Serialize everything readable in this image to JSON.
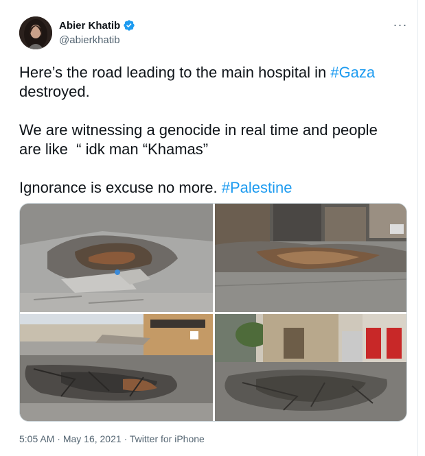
{
  "author": {
    "name": "Abier Khatib",
    "handle": "@abierkhatib",
    "verified": true
  },
  "more_icon": "more-horizontal-icon",
  "tweet": {
    "line1_text": "Here’s the road leading to the main hospital in ",
    "line1_hashtag": "#Gaza",
    "line2": "destroyed.",
    "line3": "We are witnessing a genocide in real time and people",
    "line4": "are like  “ idk man “Khamas”",
    "line5_text": "Ignorance is excuse no more. ",
    "line5_hashtag": "#Palestine"
  },
  "media": {
    "count": 4,
    "photos": [
      "road-crater-photo-1",
      "road-crater-photo-2",
      "road-crater-photo-3",
      "road-crater-photo-4"
    ]
  },
  "meta": {
    "time": "5:05 AM",
    "separator": "·",
    "date": "May 16, 2021",
    "source": "Twitter for iPhone"
  },
  "colors": {
    "link": "#1d9bf0",
    "verified": "#1d9bf0",
    "secondary_text": "#536471"
  }
}
